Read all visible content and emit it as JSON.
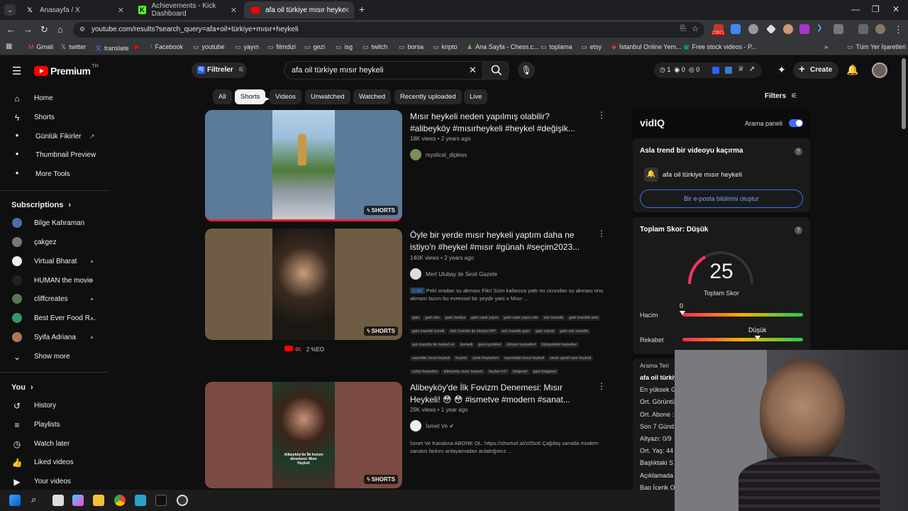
{
  "browser": {
    "tabs": [
      {
        "label": "Anasayfa / X",
        "icon": "x-logo-icon"
      },
      {
        "label": "Achievements - Kick Dashboard",
        "icon": "kick-logo-icon"
      },
      {
        "label": "afa oil türkiye mısır heykeli - Yo",
        "icon": "youtube-logo-icon",
        "active": true
      }
    ],
    "url": "youtube.com/results?search_query=afa+oil+türkiye+mısır+heykeli",
    "ext_badge": "23921",
    "bookmarks": [
      "Gmail",
      "twitter",
      "translate",
      "Facebook",
      "youtube",
      "yayın",
      "filmdizi",
      "gezi",
      "isg",
      "twitch",
      "borsa",
      "kripto",
      "Ana Sayfa - Chess.c...",
      "toplama",
      "etsy",
      "İstanbul Online Yem...",
      "Free stock videos - P...",
      "Tüm Yer İşaretleri"
    ]
  },
  "header": {
    "logo_text": "Premium",
    "country": "TR",
    "filter_btn": "Filtreler",
    "search_value": "afa oil türkiye mısır heykeli",
    "stats": [
      "1",
      "0",
      "0"
    ],
    "create": "Create"
  },
  "sidebar": {
    "main": [
      {
        "label": "Home",
        "icon": "home-icon"
      },
      {
        "label": "Shorts",
        "icon": "shorts-icon"
      },
      {
        "label": "Günlük Fikirler",
        "icon": "bulb-icon"
      },
      {
        "label": "Thumbnail Preview",
        "icon": "image-icon"
      },
      {
        "label": "More Tools",
        "icon": "tools-icon"
      }
    ],
    "subs_header": "Subscriptions",
    "subs": [
      {
        "label": "Bilge Kahraman",
        "color": "#4a6fa5",
        "dot": false
      },
      {
        "label": "çakgez",
        "color": "#777777",
        "dot": false
      },
      {
        "label": "Virtual Bharat",
        "color": "#eeeeee",
        "dot": true
      },
      {
        "label": "HUMAN the movie",
        "color": "#222222",
        "dot": true
      },
      {
        "label": "cliffcreates",
        "color": "#557755",
        "dot": true
      },
      {
        "label": "Best Ever Food R...",
        "color": "#339966",
        "dot": true
      },
      {
        "label": "Syifa Adriana",
        "color": "#aa7755",
        "dot": true
      }
    ],
    "show_more": "Show more",
    "you_header": "You",
    "you": [
      {
        "label": "History",
        "icon": "history-icon"
      },
      {
        "label": "Playlists",
        "icon": "playlists-icon"
      },
      {
        "label": "Watch later",
        "icon": "clock-icon"
      },
      {
        "label": "Liked videos",
        "icon": "thumbs-up-icon"
      },
      {
        "label": "Your videos",
        "icon": "your-videos-icon"
      }
    ]
  },
  "chips": [
    "All",
    "Shorts",
    "Videos",
    "Unwatched",
    "Watched",
    "Recently uploaded",
    "Live"
  ],
  "chips_selected": "Shorts",
  "filters_label": "Filters",
  "results": [
    {
      "title": "Mısır heykeli neden yapılmış olabilir? #alibeyköy #mısırheykeli #heykel #değişik...",
      "meta": "18K views • 2 years ago",
      "channel": "mystical_dipless",
      "badge": "SHORTS"
    },
    {
      "title": "Öyle bir yerde mısır heykeli yaptım daha ne istiyo'n #heykel #mısır #günah #seçim2023...",
      "meta": "140K views • 2 years ago",
      "channel": "Mert Ulubay ile Sesli Gazete",
      "timestamp": "0:00",
      "desc": "Peki oradan su akması Fikri Sizin kafanıza yattı mı ucundan su akması onu akması lazım bu evrensel bir şeydir yani o Mısır ...",
      "tags": [
        "gain",
        "gain izle",
        "gain medya",
        "gain canlı yayın",
        "gain canlı yayın izle",
        "aslı inandık",
        "gain inandık vine",
        "gain inandık komik",
        "Aslı İnandık ile Heykel Mi?",
        "aslı inandık gain",
        "gain orjinal",
        "gain aslı inandık",
        "aslı inandık ile heykel mi",
        "komedi",
        "gain içerikleri",
        "türkiye heykelleri",
        "türkiyedeki heykeller",
        "nasrettin hoca heykeli",
        "heykel",
        "şehir heykelleri",
        "nasreddin hoca heykeli",
        "sinan şamil sam heykeli",
        "çirkin heykeller",
        "alibeyköy mısır heykeli",
        "heykel mi?",
        "belgesel",
        "gain belgesel"
      ],
      "yt_stat": "4K",
      "eo_stat": "2 %EO",
      "badge": "SHORTS"
    },
    {
      "title": "Alibeyköy'de İlk Fovizm Denemesi: Mısır Heykeli! 😳 😳 #ismetve #modern #sanat...",
      "meta": "29K views • 1 year ago",
      "channel": "İsmet Ve",
      "desc": "İsmet Ve Kanalına ABONE OL: https://shorturl.at/z0So6 Çağdaş sanatla modern sanatın farkını anlayamadan anlattığımız ...",
      "badge": "SHORTS"
    }
  ],
  "vidiq": {
    "brand": "vidIQ",
    "panel_toggle": "Arama paneli",
    "trend_title": "Asla trend bir videoyu kaçırma",
    "trend_query": "afa oil türkiye mısır heykeli",
    "notify_btn": "Bir e-posta bildirimi oluştur",
    "score_title": "Toplam Skor: Düşük",
    "score": "25",
    "score_caption": "Toplam Skor",
    "volume_label": "Hacim",
    "volume_value": "0",
    "competition_label": "Rekabet",
    "competition_value": "Düşük",
    "search_terms_header": "Arama Teri",
    "search_terms": [
      "afa oil türkiy",
      "En yüksek G",
      "Ort. Görüntü",
      "Ort. Abone :",
      "Son 7 Günd",
      "Altyazı: 0/9",
      "Ort. Yaş: 44",
      "Başlıktaki S",
      "Açıklamada",
      "Bap İçerik O"
    ]
  }
}
